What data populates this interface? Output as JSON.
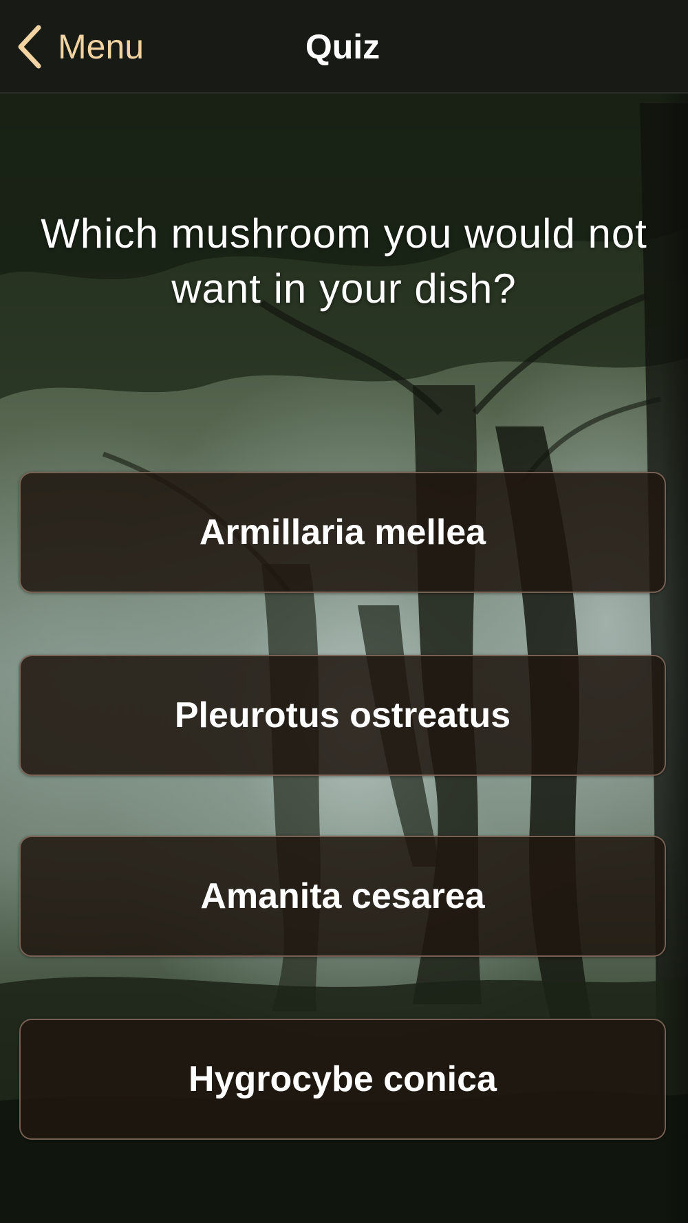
{
  "navbar": {
    "back_label": "Menu",
    "title": "Quiz"
  },
  "question": "Which mushroom you would not want in your dish?",
  "answers": [
    "Armillaria mellea",
    "Pleurotus ostreatus",
    "Amanita cesarea",
    "Hygrocybe conica"
  ],
  "colors": {
    "navbar_background": "#171a15",
    "back_accent": "#f2d3a2",
    "answer_background": "#20160f",
    "answer_border": "#967869",
    "text": "#ffffff"
  },
  "icons": {
    "back": "chevron-left-icon"
  }
}
